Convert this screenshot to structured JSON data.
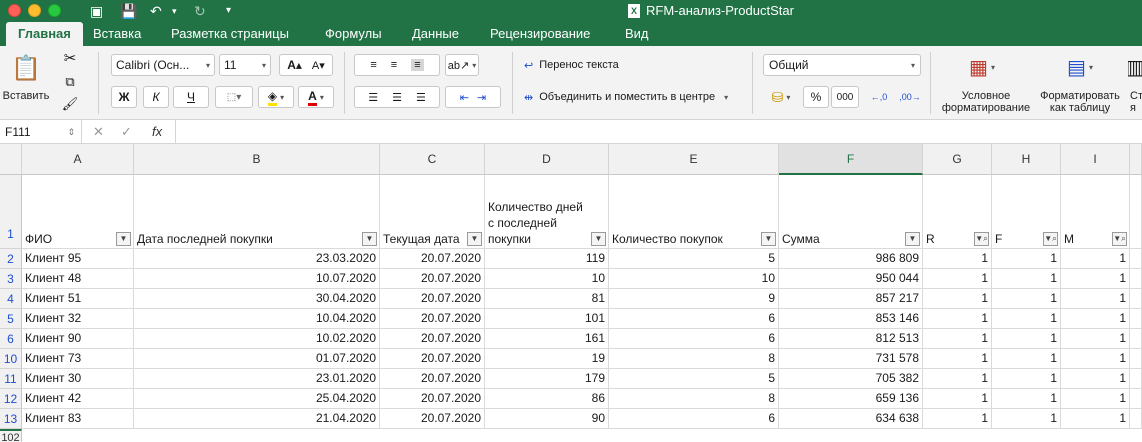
{
  "window": {
    "title": "RFM-анализ-ProductStar"
  },
  "tabs": [
    "Главная",
    "Вставка",
    "Разметка страницы",
    "Формулы",
    "Данные",
    "Рецензирование",
    "Вид"
  ],
  "ribbon": {
    "paste_label": "Вставить",
    "font_name": "Calibri (Осн...",
    "font_size": "11",
    "bold": "Ж",
    "italic": "К",
    "underline": "Ч",
    "wrap_text": "Перенос текста",
    "merge_center": "Объединить и поместить в центре",
    "number_format": "Общий",
    "percent": "%",
    "thousands": "000",
    "conditional_formatting": "Условное форматирование",
    "format_as_table": "Форматировать как таблицу",
    "cell_styles_cut": "Ст я"
  },
  "formula_bar": {
    "name_box": "F111",
    "fx": "fx"
  },
  "grid": {
    "columns": [
      "A",
      "B",
      "C",
      "D",
      "E",
      "F",
      "G",
      "H",
      "I"
    ],
    "selected_column": "F",
    "headers": {
      "a": "ФИО",
      "b": "Дата последней покупки",
      "c": "Текущая дата",
      "d": "Количество дней с последней покупки",
      "e": "Количество покупок",
      "f": "Сумма",
      "g": "R",
      "h": "F",
      "i": "M"
    },
    "row_numbers": [
      "1",
      "2",
      "3",
      "4",
      "5",
      "6",
      "10",
      "11",
      "12",
      "13",
      "102"
    ],
    "rows": [
      [
        "Клиент 95",
        "23.03.2020",
        "20.07.2020",
        "119",
        "5",
        "986 809",
        "1",
        "1",
        "1"
      ],
      [
        "Клиент 48",
        "10.07.2020",
        "20.07.2020",
        "10",
        "10",
        "950 044",
        "1",
        "1",
        "1"
      ],
      [
        "Клиент 51",
        "30.04.2020",
        "20.07.2020",
        "81",
        "9",
        "857 217",
        "1",
        "1",
        "1"
      ],
      [
        "Клиент 32",
        "10.04.2020",
        "20.07.2020",
        "101",
        "6",
        "853 146",
        "1",
        "1",
        "1"
      ],
      [
        "Клиент 90",
        "10.02.2020",
        "20.07.2020",
        "161",
        "6",
        "812 513",
        "1",
        "1",
        "1"
      ],
      [
        "Клиент 73",
        "01.07.2020",
        "20.07.2020",
        "19",
        "8",
        "731 578",
        "1",
        "1",
        "1"
      ],
      [
        "Клиент 30",
        "23.01.2020",
        "20.07.2020",
        "179",
        "5",
        "705 382",
        "1",
        "1",
        "1"
      ],
      [
        "Клиент 42",
        "25.04.2020",
        "20.07.2020",
        "86",
        "8",
        "659 136",
        "1",
        "1",
        "1"
      ],
      [
        "Клиент 83",
        "21.04.2020",
        "20.07.2020",
        "90",
        "6",
        "634 638",
        "1",
        "1",
        "1"
      ]
    ]
  },
  "colors": {
    "accent": "#217346",
    "row_number": "#1f4fcf"
  }
}
